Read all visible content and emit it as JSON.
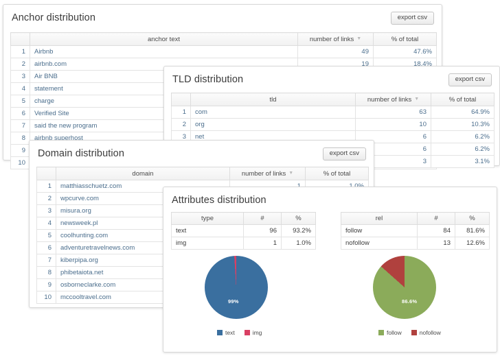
{
  "panels": {
    "anchor": {
      "title": "Anchor distribution",
      "export_label": "export csv",
      "columns": [
        "",
        "anchor text",
        "number of links",
        "% of total"
      ],
      "rows": [
        {
          "idx": "1",
          "label": "Airbnb",
          "links": "49",
          "pct": "47.6%"
        },
        {
          "idx": "2",
          "label": "airbnb.com",
          "links": "19",
          "pct": "18.4%"
        },
        {
          "idx": "3",
          "label": "Air BNB",
          "links": "",
          "pct": ""
        },
        {
          "idx": "4",
          "label": "statement",
          "links": "",
          "pct": ""
        },
        {
          "idx": "5",
          "label": "charge",
          "links": "",
          "pct": ""
        },
        {
          "idx": "6",
          "label": "Verified Site",
          "links": "",
          "pct": ""
        },
        {
          "idx": "7",
          "label": "said the new program",
          "links": "",
          "pct": ""
        },
        {
          "idx": "8",
          "label": "airbnb superhost",
          "links": "",
          "pct": ""
        },
        {
          "idx": "9",
          "label": "",
          "links": "",
          "pct": ""
        },
        {
          "idx": "10",
          "label": "",
          "links": "",
          "pct": ""
        }
      ]
    },
    "tld": {
      "title": "TLD distribution",
      "export_label": "export csv",
      "columns": [
        "",
        "tld",
        "number of links",
        "% of total"
      ],
      "rows": [
        {
          "idx": "1",
          "label": "com",
          "links": "63",
          "pct": "64.9%"
        },
        {
          "idx": "2",
          "label": "org",
          "links": "10",
          "pct": "10.3%"
        },
        {
          "idx": "3",
          "label": "net",
          "links": "6",
          "pct": "6.2%"
        },
        {
          "idx": "4",
          "label": "",
          "links": "6",
          "pct": "6.2%"
        },
        {
          "idx": "5",
          "label": "",
          "links": "3",
          "pct": "3.1%"
        }
      ]
    },
    "domain": {
      "title": "Domain distribution",
      "export_label": "export csv",
      "columns": [
        "",
        "domain",
        "number of links",
        "% of total"
      ],
      "rows": [
        {
          "idx": "1",
          "label": "matthiasschuetz.com",
          "links": "1",
          "pct": "1.0%"
        },
        {
          "idx": "2",
          "label": "wpcurve.com",
          "links": "",
          "pct": ""
        },
        {
          "idx": "3",
          "label": "misura.org",
          "links": "",
          "pct": ""
        },
        {
          "idx": "4",
          "label": "newsweek.pl",
          "links": "",
          "pct": ""
        },
        {
          "idx": "5",
          "label": "coolhunting.com",
          "links": "",
          "pct": ""
        },
        {
          "idx": "6",
          "label": "adventuretravelnews.com",
          "links": "",
          "pct": ""
        },
        {
          "idx": "7",
          "label": "kiberpipa.org",
          "links": "",
          "pct": ""
        },
        {
          "idx": "8",
          "label": "phibetaiota.net",
          "links": "",
          "pct": ""
        },
        {
          "idx": "9",
          "label": "osborneclarke.com",
          "links": "",
          "pct": ""
        },
        {
          "idx": "10",
          "label": "mccooltravel.com",
          "links": "",
          "pct": ""
        }
      ]
    },
    "attributes": {
      "title": "Attributes distribution",
      "type_table": {
        "columns": [
          "type",
          "#",
          "%"
        ],
        "rows": [
          {
            "label": "text",
            "count": "96",
            "pct": "93.2%"
          },
          {
            "label": "img",
            "count": "1",
            "pct": "1.0%"
          }
        ]
      },
      "rel_table": {
        "columns": [
          "rel",
          "#",
          "%"
        ],
        "rows": [
          {
            "label": "follow",
            "count": "84",
            "pct": "81.6%"
          },
          {
            "label": "nofollow",
            "count": "13",
            "pct": "12.6%"
          }
        ]
      }
    }
  },
  "chart_data": [
    {
      "type": "pie",
      "title": "type",
      "categories": [
        "text",
        "img"
      ],
      "values": [
        96,
        1
      ],
      "slice_labels": [
        "99%",
        ""
      ],
      "colors": [
        "#3a6f9f",
        "#d93f63"
      ],
      "legend": [
        "text",
        "img"
      ],
      "legend_position": "bottom"
    },
    {
      "type": "pie",
      "title": "rel",
      "categories": [
        "follow",
        "nofollow"
      ],
      "values": [
        84,
        13
      ],
      "slice_labels": [
        "86.6%",
        ""
      ],
      "colors": [
        "#8bab5a",
        "#b0413e"
      ],
      "legend": [
        "follow",
        "nofollow"
      ],
      "legend_position": "bottom"
    }
  ]
}
